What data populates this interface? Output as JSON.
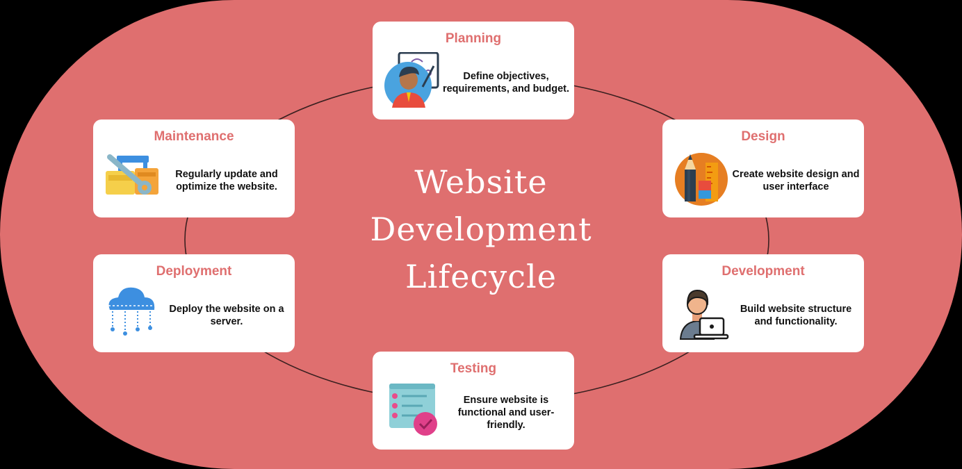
{
  "title": {
    "line1": "Website",
    "line2": "Development",
    "line3": "Lifecycle"
  },
  "colors": {
    "background": "#df6f6f",
    "card": "#ffffff",
    "accent_title": "#df6f6f",
    "cycle_line": "#3a2020"
  },
  "stages": {
    "planning": {
      "title": "Planning",
      "description": "Define objectives, requirements, and budget.",
      "icon": "presenter-whiteboard-icon"
    },
    "design": {
      "title": "Design",
      "description": "Create website design and user interface",
      "icon": "pencil-ruler-icon"
    },
    "development": {
      "title": "Development",
      "description": "Build website structure and functionality.",
      "icon": "developer-laptop-icon"
    },
    "testing": {
      "title": "Testing",
      "description": "Ensure website is functional and user-friendly.",
      "icon": "checklist-icon"
    },
    "deployment": {
      "title": "Deployment",
      "description": "Deploy the website on a server.",
      "icon": "cloud-network-icon"
    },
    "maintenance": {
      "title": "Maintenance",
      "description": "Regularly update and optimize the website.",
      "icon": "toolbox-wrench-icon"
    }
  }
}
